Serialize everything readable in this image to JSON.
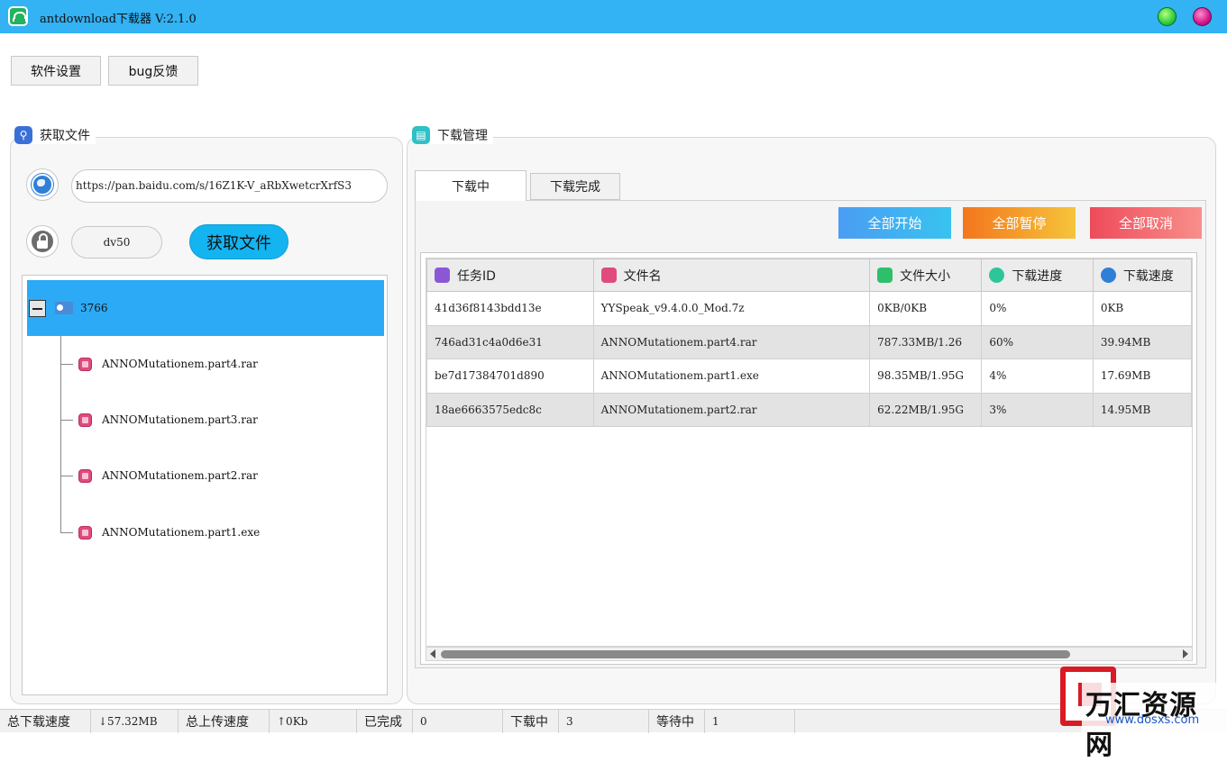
{
  "window": {
    "title": "antdownload下载器  V:2.1.0"
  },
  "toolbar": {
    "settings_label": "软件设置",
    "bug_label": "bug反馈"
  },
  "left_panel": {
    "title": "获取文件",
    "url_value": "https://pan.baidu.com/s/16Z1K-V_aRbXwetcrXrfS3",
    "code_value": "dv50",
    "fetch_label": "获取文件",
    "tree": {
      "root_label": "3766",
      "files": [
        "ANNOMutationem.part4.rar",
        "ANNOMutationem.part3.rar",
        "ANNOMutationem.part2.rar",
        "ANNOMutationem.part1.exe"
      ]
    }
  },
  "right_panel": {
    "title": "下载管理",
    "tabs": [
      "下载中",
      "下载完成"
    ],
    "active_tab": "下载中",
    "actions": {
      "start_all": "全部开始",
      "pause_all": "全部暂停",
      "cancel_all": "全部取消"
    },
    "table": {
      "columns": [
        "任务ID",
        "文件名",
        "文件大小",
        "下载进度",
        "下载速度"
      ],
      "column_icons": [
        "edit-icon",
        "file-icon",
        "size-icon",
        "check-icon",
        "speed-icon"
      ],
      "rows": [
        [
          "41d36f8143bdd13e",
          "YYSpeak_v9.4.0.0_Mod.7z",
          "0KB/0KB",
          "0%",
          "0KB"
        ],
        [
          "746ad31c4a0d6e31",
          "ANNOMutationem.part4.rar",
          "787.33MB/1.26",
          "60%",
          "39.94MB"
        ],
        [
          "be7d17384701d890",
          "ANNOMutationem.part1.exe",
          "98.35MB/1.95G",
          "4%",
          "17.69MB"
        ],
        [
          "18ae6663575edc8c",
          "ANNOMutationem.part2.rar",
          "62.22MB/1.95G",
          "3%",
          "14.95MB"
        ]
      ]
    }
  },
  "statusbar": {
    "total_down_label": "总下载速度",
    "total_down_value": "↓57.32MB",
    "total_up_label": "总上传速度",
    "total_up_value": "↑0Kb",
    "done_label": "已完成",
    "done_value": "0",
    "downloading_label": "下载中",
    "downloading_value": "3",
    "waiting_label": "等待中",
    "waiting_value": "1"
  },
  "watermark": {
    "text": "万汇资源网",
    "url": "www.dosxs.com"
  },
  "colors": {
    "titlebar": "#33b2f4",
    "selection": "#2daaf5",
    "fetch_button": "#13b4f0"
  }
}
